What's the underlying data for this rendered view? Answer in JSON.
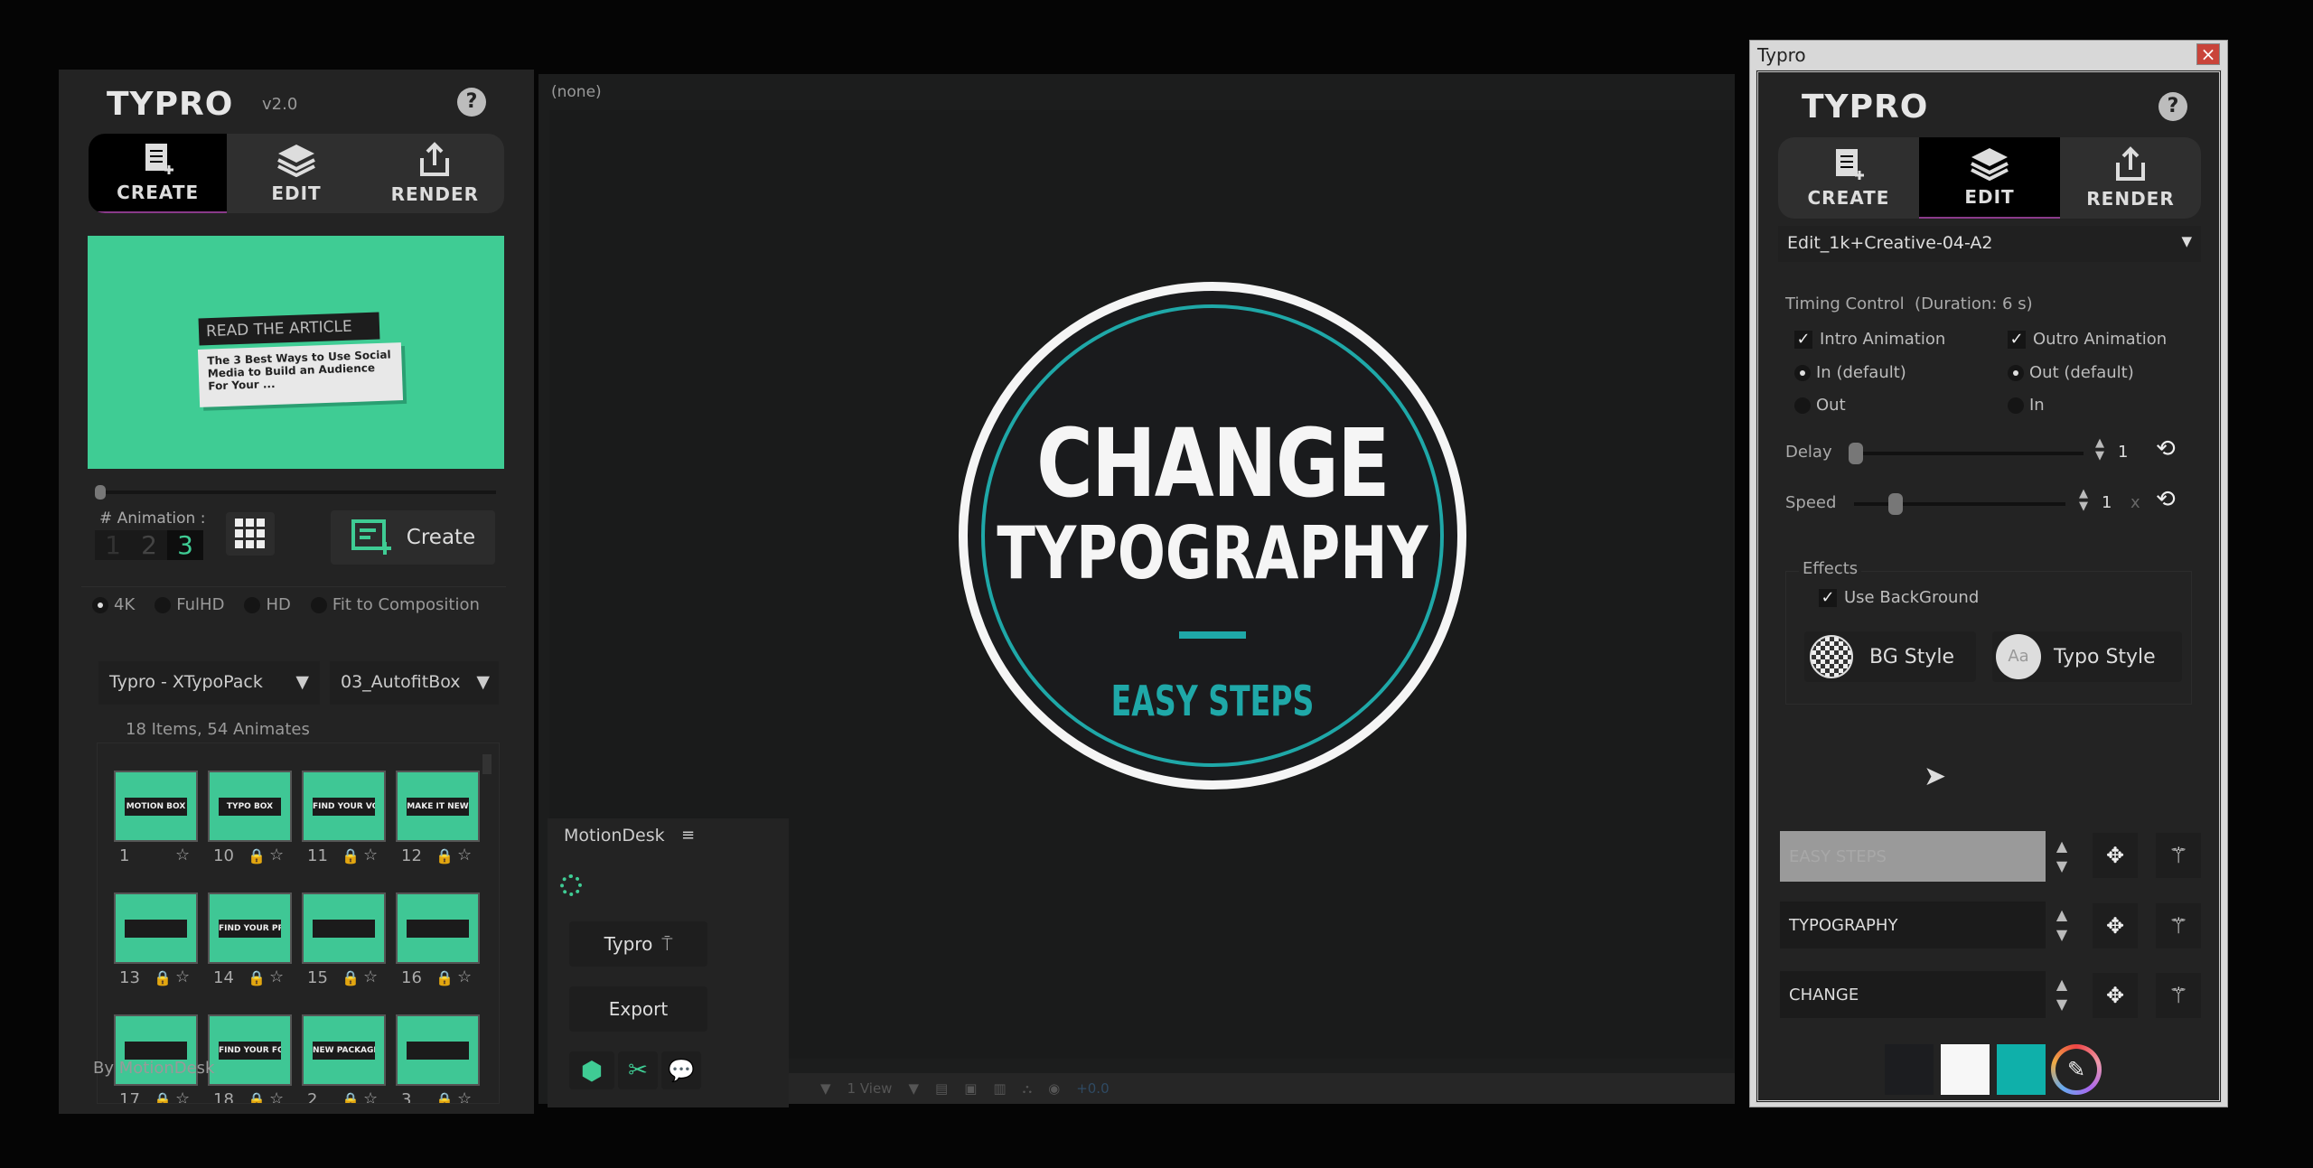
{
  "left_panel": {
    "logo": "TYPRO",
    "version": "v2.0",
    "help": "?",
    "tabs": [
      {
        "label": "CREATE",
        "active": true
      },
      {
        "label": "EDIT"
      },
      {
        "label": "RENDER"
      }
    ],
    "preview": {
      "header": "READ THE ARTICLE",
      "body": "The 3 Best Ways to Use Social Media to Build an Audience For Your ...",
      "bg_color": "#3fcc94"
    },
    "animation_label": "# Animation :",
    "animation_options": [
      "1",
      "2",
      "3"
    ],
    "animation_selected": "3",
    "create_label": "Create",
    "resolutions": [
      {
        "label": "4K",
        "selected": true
      },
      {
        "label": "FulHD"
      },
      {
        "label": "HD"
      },
      {
        "label": "Fit to Composition"
      }
    ],
    "pack_select": "Typro - XTypoPack",
    "category_select": "03_AutofitBox",
    "items_count": "18 Items, 54 Animates",
    "items": [
      {
        "n": "1",
        "locked": false,
        "t": "MOTION BOX"
      },
      {
        "n": "10",
        "locked": true,
        "t": "TYPO BOX"
      },
      {
        "n": "11",
        "locked": true,
        "t": "FIND YOUR VOICE BRAND"
      },
      {
        "n": "12",
        "locked": true,
        "t": "MAKE IT NEW"
      },
      {
        "n": "13",
        "locked": true,
        "t": ""
      },
      {
        "n": "14",
        "locked": true,
        "t": "FIND YOUR PRODUCTIVE TIME"
      },
      {
        "n": "15",
        "locked": true,
        "t": ""
      },
      {
        "n": "16",
        "locked": true,
        "t": ""
      },
      {
        "n": "17",
        "locked": true,
        "t": ""
      },
      {
        "n": "18",
        "locked": true,
        "t": "FIND YOUR FOCUS"
      },
      {
        "n": "2",
        "locked": true,
        "t": "NEW PACKAGE"
      },
      {
        "n": "3",
        "locked": true,
        "t": ""
      },
      {
        "n": "",
        "locked": false,
        "t": ""
      },
      {
        "n": "",
        "locked": false,
        "t": ""
      },
      {
        "n": "",
        "locked": false,
        "t": ""
      },
      {
        "n": "",
        "locked": false,
        "t": ""
      }
    ],
    "footer": "By MotionDesk"
  },
  "viewer": {
    "comp_name": "(none)",
    "headline_1": "CHANGE",
    "headline_2": "TYPOGRAPHY",
    "subline": "EASY STEPS",
    "accent": "#1fa8a8",
    "view_select": "1 View",
    "zoom_value": "+0.0"
  },
  "motiondesk": {
    "title": "MotionDesk",
    "menu": "≡",
    "typro_button": "Typro",
    "export_button": "Export"
  },
  "right_window": {
    "title": "Typro",
    "close": "×",
    "logo": "TYPRO",
    "help": "?",
    "tabs": [
      {
        "label": "CREATE"
      },
      {
        "label": "EDIT",
        "active": true
      },
      {
        "label": "RENDER"
      }
    ],
    "comp_select": "Edit_1k+Creative-04-A2",
    "timing_label": "Timing Control  (Duration: 6 s)",
    "intro": {
      "label": "Intro Animation",
      "checked": true,
      "opt1": "In (default)",
      "opt2": "Out"
    },
    "outro": {
      "label": "Outro Animation",
      "checked": true,
      "opt1": "Out (default)",
      "opt2": "In"
    },
    "delay": {
      "label": "Delay",
      "value": "1",
      "slider_fraction": 0
    },
    "speed": {
      "label": "Speed",
      "value": "1",
      "unit": "x",
      "slider_fraction": 0.15
    },
    "effects_label": "Effects",
    "use_bg": "Use BackGround",
    "bg_style": "BG Style",
    "typo_style": "Typo Style",
    "typo_icon_text": "Aa",
    "text_layers": [
      "EASY STEPS",
      "TYPOGRAPHY",
      "CHANGE"
    ],
    "swatches": [
      "#1c1d20",
      "#f7f7f7",
      "#0fb0aa"
    ]
  }
}
